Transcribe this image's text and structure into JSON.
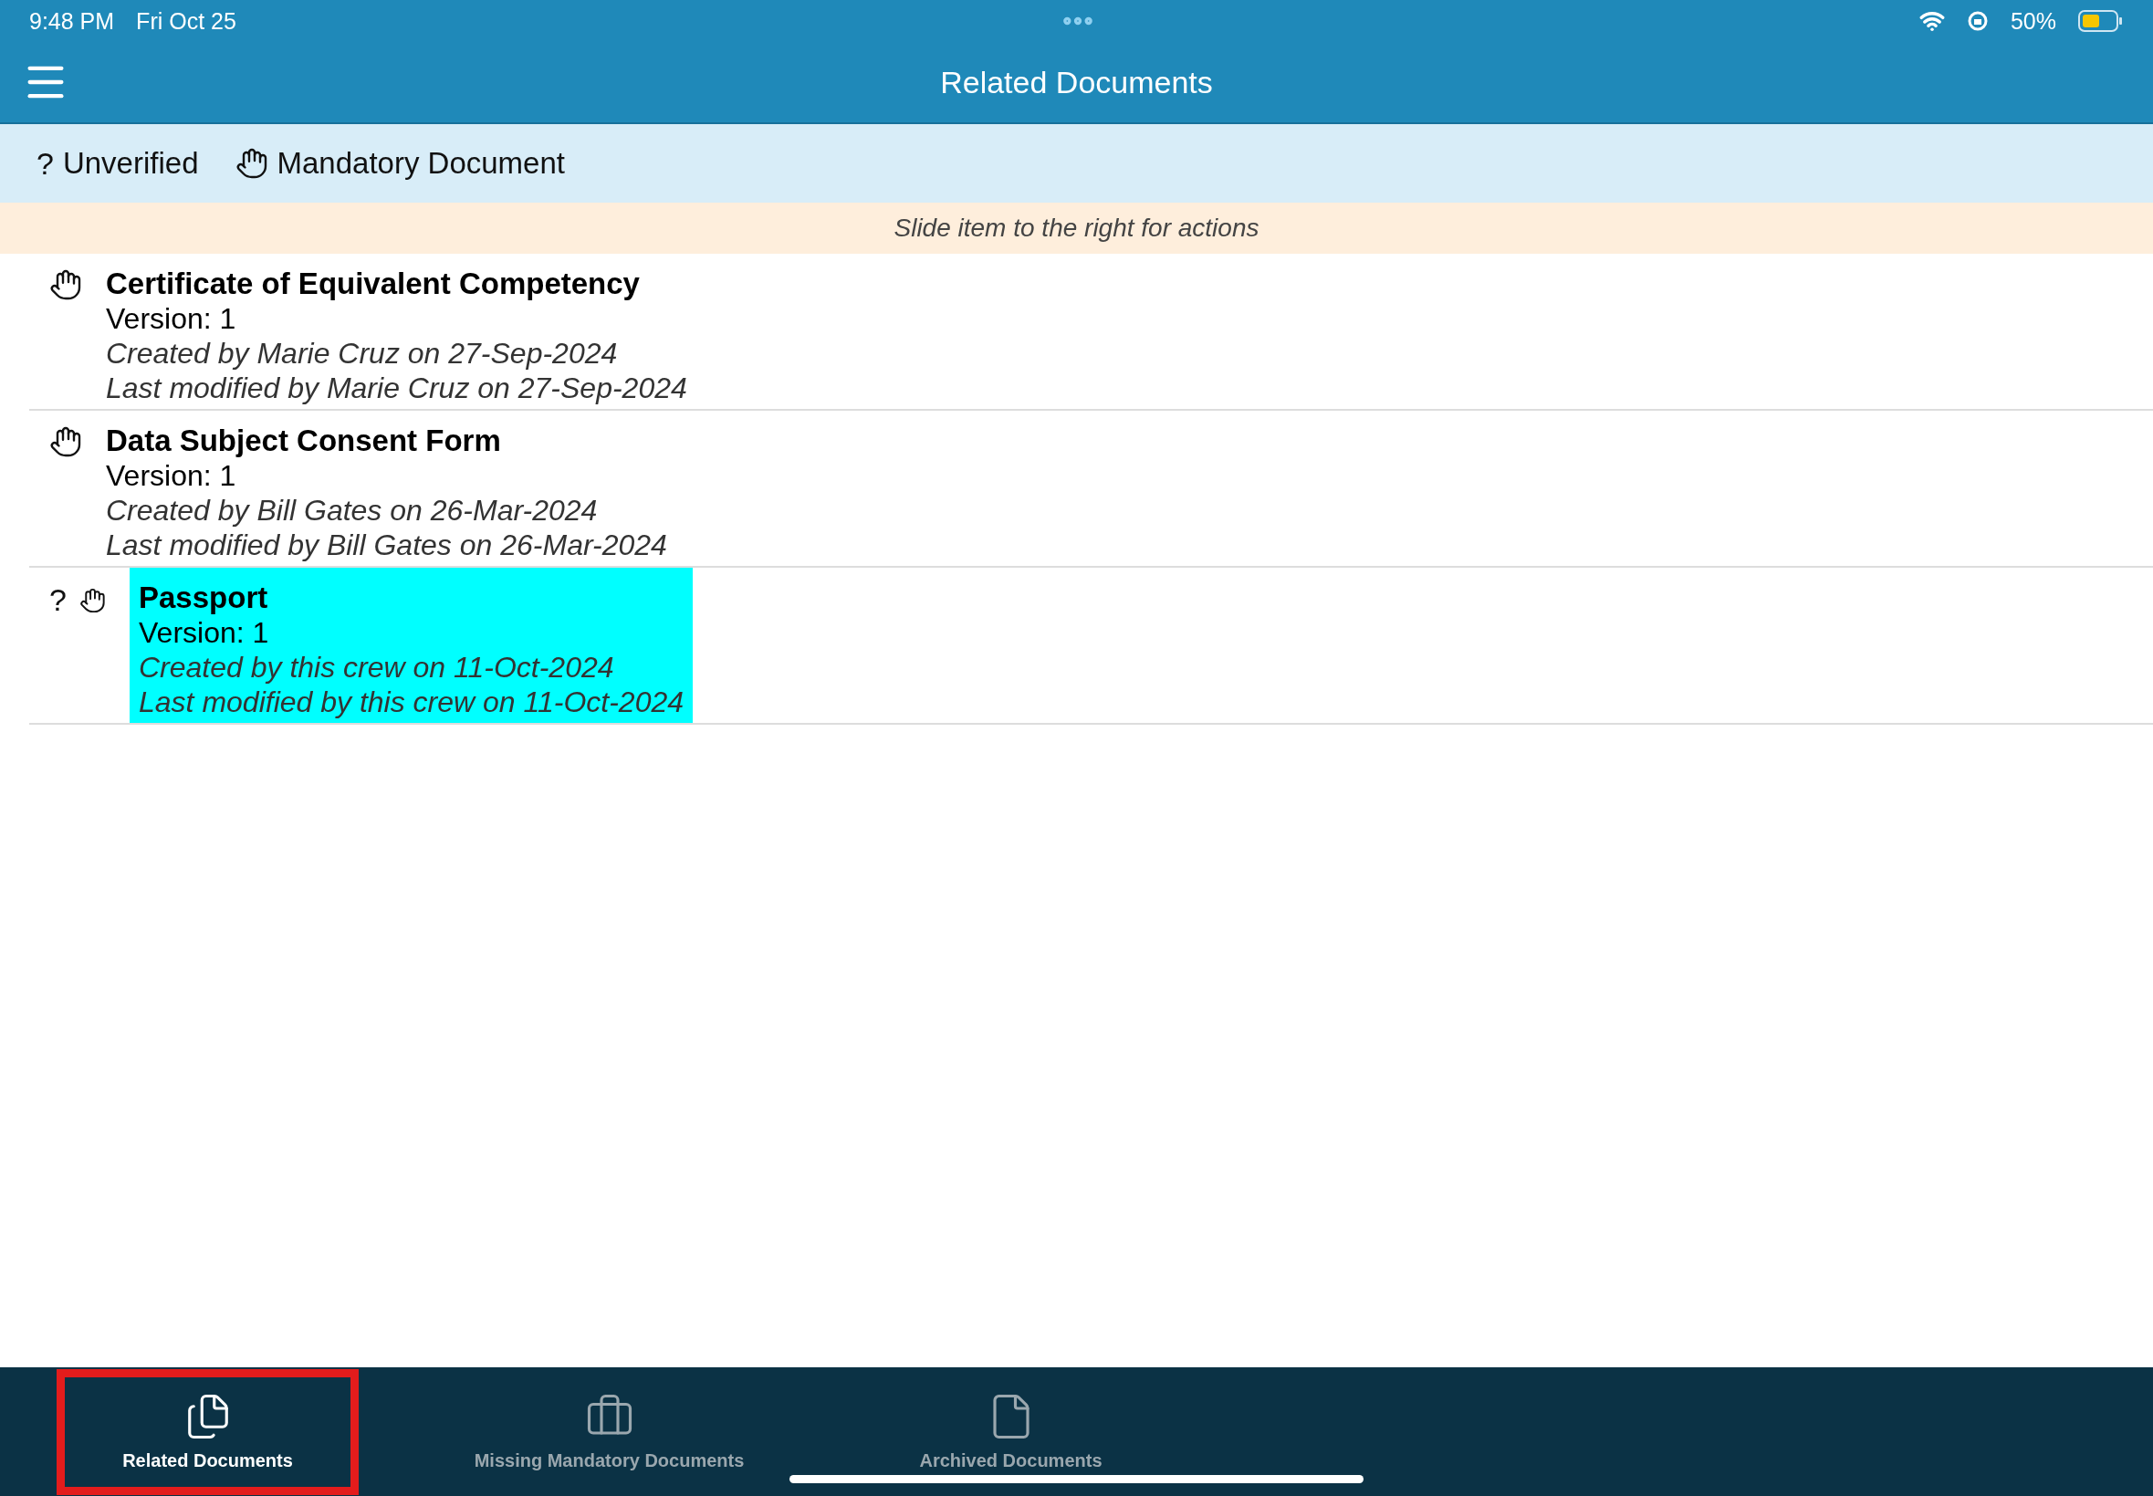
{
  "status_bar": {
    "time": "9:48 PM",
    "date": "Fri Oct 25",
    "battery": "50%"
  },
  "header": {
    "title": "Related Documents"
  },
  "legend": [
    {
      "kind": "symbol",
      "symbol": "?",
      "label": "Unverified"
    },
    {
      "kind": "hand",
      "label": "Mandatory Document"
    }
  ],
  "hint": "Slide item to the right for actions",
  "documents": [
    {
      "title": "Certificate of Equivalent Competency",
      "version": "Version: 1",
      "created": "Created by Marie Cruz on 27-Sep-2024",
      "modified": "Last modified by Marie Cruz on 27-Sep-2024",
      "mandatory": true,
      "highlighted": false
    },
    {
      "title": "Data Subject Consent Form",
      "version": "Version: 1",
      "created": "Created by Bill Gates on 26-Mar-2024",
      "modified": "Last modified by Bill Gates on 26-Mar-2024",
      "mandatory": true,
      "highlighted": false
    },
    {
      "title": "Passport",
      "version": "Version: 1",
      "created": "Created by this crew on 11-Oct-2024",
      "modified": "Last modified by this crew on 11-Oct-2024",
      "unverified_mark": "?",
      "mandatory": true,
      "highlighted": true
    }
  ],
  "tabs": [
    {
      "kind": "files",
      "label": "Related Documents",
      "selected": true,
      "outlined": true
    },
    {
      "kind": "briefcase",
      "label": "Missing Mandatory Documents",
      "selected": false,
      "outlined": false
    },
    {
      "kind": "file",
      "label": "Archived Documents",
      "selected": false,
      "outlined": false
    }
  ]
}
